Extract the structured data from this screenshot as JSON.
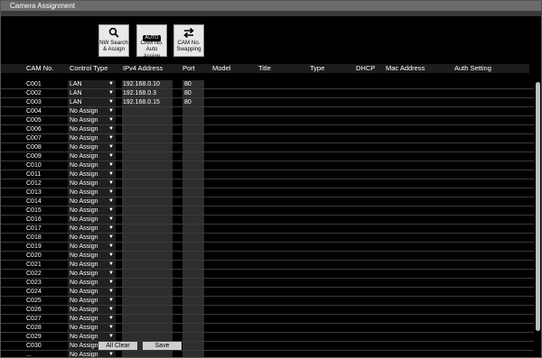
{
  "window": {
    "title": "Camera Assignment"
  },
  "toolbar": {
    "nw_search": {
      "line1": "NW Search",
      "line2": "& Assign"
    },
    "auto_assign": {
      "badge": "AUTO",
      "line1": "CAM No.",
      "line2": "Auto Assign"
    },
    "swapping": {
      "line1": "CAM No.",
      "line2": "Swapping"
    }
  },
  "table": {
    "headers": {
      "cam_no": "CAM No.",
      "control_type": "Control Type",
      "ipv4": "IPv4 Address",
      "port": "Port",
      "model": "Model",
      "title": "Title",
      "type": "Type",
      "dhcp": "DHCP",
      "mac": "Mac Address",
      "auth": "Auth Setting"
    },
    "rows": [
      {
        "cam": "C001",
        "control": "LAN",
        "ip": "192.168.0.10",
        "port": "80"
      },
      {
        "cam": "C002",
        "control": "LAN",
        "ip": "192.168.0.3",
        "port": "80"
      },
      {
        "cam": "C003",
        "control": "LAN",
        "ip": "192.168.0.15",
        "port": "80"
      },
      {
        "cam": "C004",
        "control": "No Assign",
        "ip": "",
        "port": ""
      },
      {
        "cam": "C005",
        "control": "No Assign",
        "ip": "",
        "port": ""
      },
      {
        "cam": "C006",
        "control": "No Assign",
        "ip": "",
        "port": ""
      },
      {
        "cam": "C007",
        "control": "No Assign",
        "ip": "",
        "port": ""
      },
      {
        "cam": "C008",
        "control": "No Assign",
        "ip": "",
        "port": ""
      },
      {
        "cam": "C009",
        "control": "No Assign",
        "ip": "",
        "port": ""
      },
      {
        "cam": "C010",
        "control": "No Assign",
        "ip": "",
        "port": ""
      },
      {
        "cam": "C011",
        "control": "No Assign",
        "ip": "",
        "port": ""
      },
      {
        "cam": "C012",
        "control": "No Assign",
        "ip": "",
        "port": ""
      },
      {
        "cam": "C013",
        "control": "No Assign",
        "ip": "",
        "port": ""
      },
      {
        "cam": "C014",
        "control": "No Assign",
        "ip": "",
        "port": ""
      },
      {
        "cam": "C015",
        "control": "No Assign",
        "ip": "",
        "port": ""
      },
      {
        "cam": "C016",
        "control": "No Assign",
        "ip": "",
        "port": ""
      },
      {
        "cam": "C017",
        "control": "No Assign",
        "ip": "",
        "port": ""
      },
      {
        "cam": "C018",
        "control": "No Assign",
        "ip": "",
        "port": ""
      },
      {
        "cam": "C019",
        "control": "No Assign",
        "ip": "",
        "port": ""
      },
      {
        "cam": "C020",
        "control": "No Assign",
        "ip": "",
        "port": ""
      },
      {
        "cam": "C021",
        "control": "No Assign",
        "ip": "",
        "port": ""
      },
      {
        "cam": "C022",
        "control": "No Assign",
        "ip": "",
        "port": ""
      },
      {
        "cam": "C023",
        "control": "No Assign",
        "ip": "",
        "port": ""
      },
      {
        "cam": "C024",
        "control": "No Assign",
        "ip": "",
        "port": ""
      },
      {
        "cam": "C025",
        "control": "No Assign",
        "ip": "",
        "port": ""
      },
      {
        "cam": "C026",
        "control": "No Assign",
        "ip": "",
        "port": ""
      },
      {
        "cam": "C027",
        "control": "No Assign",
        "ip": "",
        "port": ""
      },
      {
        "cam": "C028",
        "control": "No Assign",
        "ip": "",
        "port": ""
      },
      {
        "cam": "C029",
        "control": "No Assign",
        "ip": "",
        "port": ""
      },
      {
        "cam": "C030",
        "control": "No Assign",
        "ip": "",
        "port": ""
      },
      {
        "cam": "...",
        "control": "No Assign",
        "ip": "",
        "port": ""
      }
    ]
  },
  "footer": {
    "all_clear": "All Clear",
    "save": "Save"
  },
  "icons": {
    "dropdown": "dropdown-arrow-icon",
    "search": "search-icon",
    "swap": "swap-arrows-icon"
  },
  "colors": {
    "title_bar": "#6b6b6b",
    "button_bg": "#e8e8e8",
    "background": "#000000"
  }
}
